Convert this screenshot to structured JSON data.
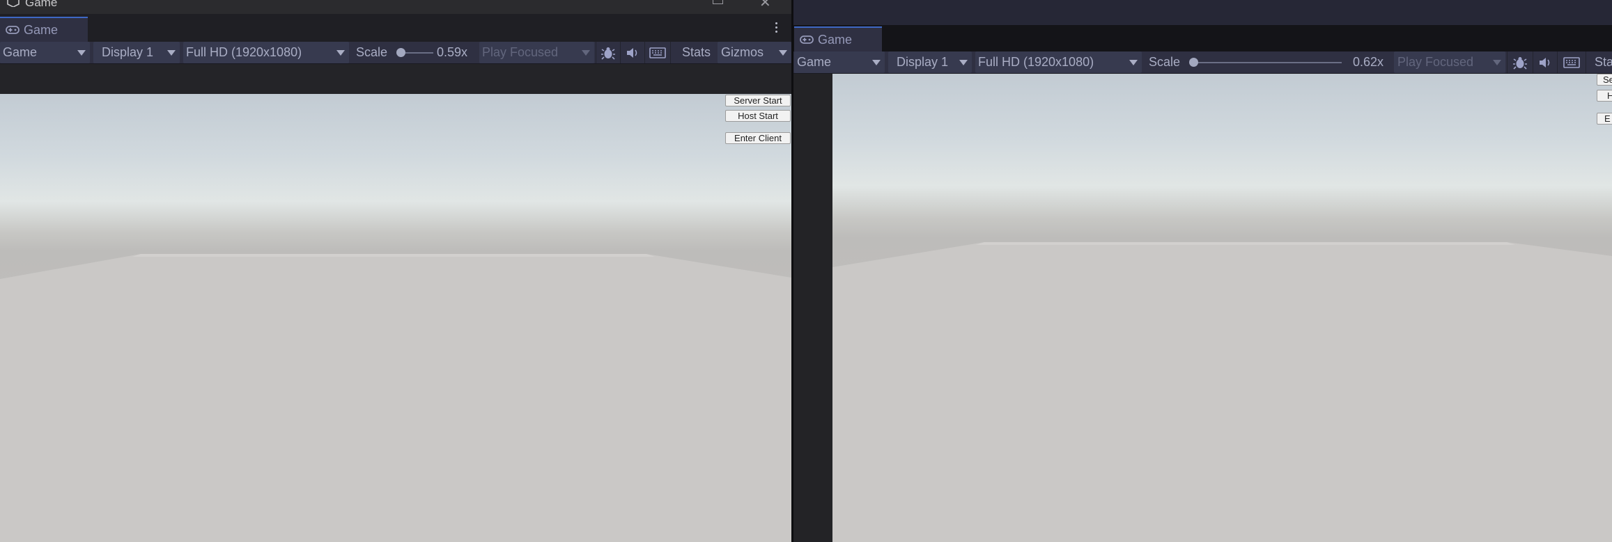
{
  "left_window": {
    "os_title": "Game",
    "tab_label": "Game",
    "toolbar": {
      "mode": "Game",
      "display": "Display 1",
      "resolution": "Full HD (1920x1080)",
      "scale_label": "Scale",
      "scale_value": "0.59x",
      "play_mode": "Play Focused",
      "stats_label": "Stats",
      "gizmos_label": "Gizmos"
    },
    "overlay_buttons": {
      "server_start": "Server Start",
      "host_start": "Host Start",
      "enter_client": "Enter Client"
    }
  },
  "right_window": {
    "tab_label": "Game",
    "toolbar": {
      "mode": "Game",
      "display": "Display 1",
      "resolution": "Full HD (1920x1080)",
      "scale_label": "Scale",
      "scale_value": "0.62x",
      "play_mode": "Play Focused",
      "stats_label": "Sta"
    },
    "overlay_buttons": {
      "server_start": "Se",
      "host_start": "H",
      "enter_client": "E"
    }
  },
  "colors": {
    "accent_tab": "#3e68c5",
    "toolbar_bg": "#2f3042",
    "sky_top": "#c2cbd3",
    "horizon": "#e1e6e5",
    "ground": "#cac8c6"
  },
  "icons": [
    "unity-icon",
    "maximize-icon",
    "close-icon",
    "gamepad-icon",
    "kebab-menu-icon",
    "bug-icon",
    "audio-icon",
    "keyboard-icon"
  ]
}
